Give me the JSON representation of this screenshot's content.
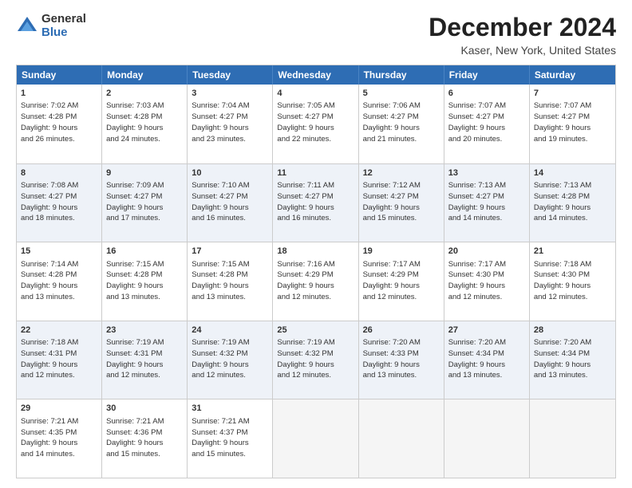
{
  "logo": {
    "general": "General",
    "blue": "Blue"
  },
  "header": {
    "title": "December 2024",
    "subtitle": "Kaser, New York, United States"
  },
  "calendar": {
    "days": [
      "Sunday",
      "Monday",
      "Tuesday",
      "Wednesday",
      "Thursday",
      "Friday",
      "Saturday"
    ],
    "rows": [
      [
        {
          "num": "1",
          "lines": [
            "Sunrise: 7:02 AM",
            "Sunset: 4:28 PM",
            "Daylight: 9 hours",
            "and 26 minutes."
          ]
        },
        {
          "num": "2",
          "lines": [
            "Sunrise: 7:03 AM",
            "Sunset: 4:28 PM",
            "Daylight: 9 hours",
            "and 24 minutes."
          ]
        },
        {
          "num": "3",
          "lines": [
            "Sunrise: 7:04 AM",
            "Sunset: 4:27 PM",
            "Daylight: 9 hours",
            "and 23 minutes."
          ]
        },
        {
          "num": "4",
          "lines": [
            "Sunrise: 7:05 AM",
            "Sunset: 4:27 PM",
            "Daylight: 9 hours",
            "and 22 minutes."
          ]
        },
        {
          "num": "5",
          "lines": [
            "Sunrise: 7:06 AM",
            "Sunset: 4:27 PM",
            "Daylight: 9 hours",
            "and 21 minutes."
          ]
        },
        {
          "num": "6",
          "lines": [
            "Sunrise: 7:07 AM",
            "Sunset: 4:27 PM",
            "Daylight: 9 hours",
            "and 20 minutes."
          ]
        },
        {
          "num": "7",
          "lines": [
            "Sunrise: 7:07 AM",
            "Sunset: 4:27 PM",
            "Daylight: 9 hours",
            "and 19 minutes."
          ]
        }
      ],
      [
        {
          "num": "8",
          "lines": [
            "Sunrise: 7:08 AM",
            "Sunset: 4:27 PM",
            "Daylight: 9 hours",
            "and 18 minutes."
          ]
        },
        {
          "num": "9",
          "lines": [
            "Sunrise: 7:09 AM",
            "Sunset: 4:27 PM",
            "Daylight: 9 hours",
            "and 17 minutes."
          ]
        },
        {
          "num": "10",
          "lines": [
            "Sunrise: 7:10 AM",
            "Sunset: 4:27 PM",
            "Daylight: 9 hours",
            "and 16 minutes."
          ]
        },
        {
          "num": "11",
          "lines": [
            "Sunrise: 7:11 AM",
            "Sunset: 4:27 PM",
            "Daylight: 9 hours",
            "and 16 minutes."
          ]
        },
        {
          "num": "12",
          "lines": [
            "Sunrise: 7:12 AM",
            "Sunset: 4:27 PM",
            "Daylight: 9 hours",
            "and 15 minutes."
          ]
        },
        {
          "num": "13",
          "lines": [
            "Sunrise: 7:13 AM",
            "Sunset: 4:27 PM",
            "Daylight: 9 hours",
            "and 14 minutes."
          ]
        },
        {
          "num": "14",
          "lines": [
            "Sunrise: 7:13 AM",
            "Sunset: 4:28 PM",
            "Daylight: 9 hours",
            "and 14 minutes."
          ]
        }
      ],
      [
        {
          "num": "15",
          "lines": [
            "Sunrise: 7:14 AM",
            "Sunset: 4:28 PM",
            "Daylight: 9 hours",
            "and 13 minutes."
          ]
        },
        {
          "num": "16",
          "lines": [
            "Sunrise: 7:15 AM",
            "Sunset: 4:28 PM",
            "Daylight: 9 hours",
            "and 13 minutes."
          ]
        },
        {
          "num": "17",
          "lines": [
            "Sunrise: 7:15 AM",
            "Sunset: 4:28 PM",
            "Daylight: 9 hours",
            "and 13 minutes."
          ]
        },
        {
          "num": "18",
          "lines": [
            "Sunrise: 7:16 AM",
            "Sunset: 4:29 PM",
            "Daylight: 9 hours",
            "and 12 minutes."
          ]
        },
        {
          "num": "19",
          "lines": [
            "Sunrise: 7:17 AM",
            "Sunset: 4:29 PM",
            "Daylight: 9 hours",
            "and 12 minutes."
          ]
        },
        {
          "num": "20",
          "lines": [
            "Sunrise: 7:17 AM",
            "Sunset: 4:30 PM",
            "Daylight: 9 hours",
            "and 12 minutes."
          ]
        },
        {
          "num": "21",
          "lines": [
            "Sunrise: 7:18 AM",
            "Sunset: 4:30 PM",
            "Daylight: 9 hours",
            "and 12 minutes."
          ]
        }
      ],
      [
        {
          "num": "22",
          "lines": [
            "Sunrise: 7:18 AM",
            "Sunset: 4:31 PM",
            "Daylight: 9 hours",
            "and 12 minutes."
          ]
        },
        {
          "num": "23",
          "lines": [
            "Sunrise: 7:19 AM",
            "Sunset: 4:31 PM",
            "Daylight: 9 hours",
            "and 12 minutes."
          ]
        },
        {
          "num": "24",
          "lines": [
            "Sunrise: 7:19 AM",
            "Sunset: 4:32 PM",
            "Daylight: 9 hours",
            "and 12 minutes."
          ]
        },
        {
          "num": "25",
          "lines": [
            "Sunrise: 7:19 AM",
            "Sunset: 4:32 PM",
            "Daylight: 9 hours",
            "and 12 minutes."
          ]
        },
        {
          "num": "26",
          "lines": [
            "Sunrise: 7:20 AM",
            "Sunset: 4:33 PM",
            "Daylight: 9 hours",
            "and 13 minutes."
          ]
        },
        {
          "num": "27",
          "lines": [
            "Sunrise: 7:20 AM",
            "Sunset: 4:34 PM",
            "Daylight: 9 hours",
            "and 13 minutes."
          ]
        },
        {
          "num": "28",
          "lines": [
            "Sunrise: 7:20 AM",
            "Sunset: 4:34 PM",
            "Daylight: 9 hours",
            "and 13 minutes."
          ]
        }
      ],
      [
        {
          "num": "29",
          "lines": [
            "Sunrise: 7:21 AM",
            "Sunset: 4:35 PM",
            "Daylight: 9 hours",
            "and 14 minutes."
          ]
        },
        {
          "num": "30",
          "lines": [
            "Sunrise: 7:21 AM",
            "Sunset: 4:36 PM",
            "Daylight: 9 hours",
            "and 15 minutes."
          ]
        },
        {
          "num": "31",
          "lines": [
            "Sunrise: 7:21 AM",
            "Sunset: 4:37 PM",
            "Daylight: 9 hours",
            "and 15 minutes."
          ]
        },
        {
          "num": "",
          "lines": []
        },
        {
          "num": "",
          "lines": []
        },
        {
          "num": "",
          "lines": []
        },
        {
          "num": "",
          "lines": []
        }
      ]
    ]
  }
}
